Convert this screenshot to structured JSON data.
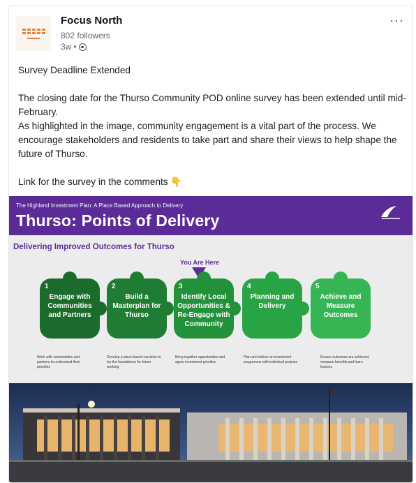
{
  "post": {
    "author": "Focus North",
    "followers": "802 followers",
    "age": "3w",
    "visibility_icon": "globe-icon",
    "more_label": "···",
    "headline": "Survey Deadline Extended",
    "paragraph1": "The closing date for the Thurso Community POD online survey has been extended until mid-February.",
    "paragraph2": "As highlighted in the image, community engagement is a vital part of the process. We encourage stakeholders and residents to take part and share their views to help shape the future of Thurso.",
    "paragraph3": "Link for the survey in the comments",
    "emoji": "👇"
  },
  "infographic": {
    "subtitle": "The Highland Investment Plan: A Place Based Approach to Delivery",
    "title": "Thurso: Points of Delivery",
    "section_title": "Delivering Improved Outcomes for Thurso",
    "you_are_here": "You Are Here",
    "steps": [
      {
        "num": "1",
        "label": "Engage with Communities and Partners",
        "desc": "Work with communities and partners to understand their priorities"
      },
      {
        "num": "2",
        "label": "Build a Masterplan for Thurso",
        "desc": "Develop a place-based narrative to lay the foundations for future working"
      },
      {
        "num": "3",
        "label": "Identify Local Opportunities & Re-Engage with Community",
        "desc": "Bring together opportunities and agree investment priorities"
      },
      {
        "num": "4",
        "label": "Planning and Delivery",
        "desc": "Plan and deliver an investment programme with individual projects"
      },
      {
        "num": "5",
        "label": "Achieve and Measure Outcomes",
        "desc": "Ensure outcomes are achieved, measure benefits and learn lessons"
      }
    ],
    "colors": {
      "banner": "#5b2c98",
      "step1": "#1b6b2c",
      "step2": "#1e7d33",
      "step3": "#22913a",
      "step4": "#28a445",
      "step5": "#35b553"
    }
  }
}
